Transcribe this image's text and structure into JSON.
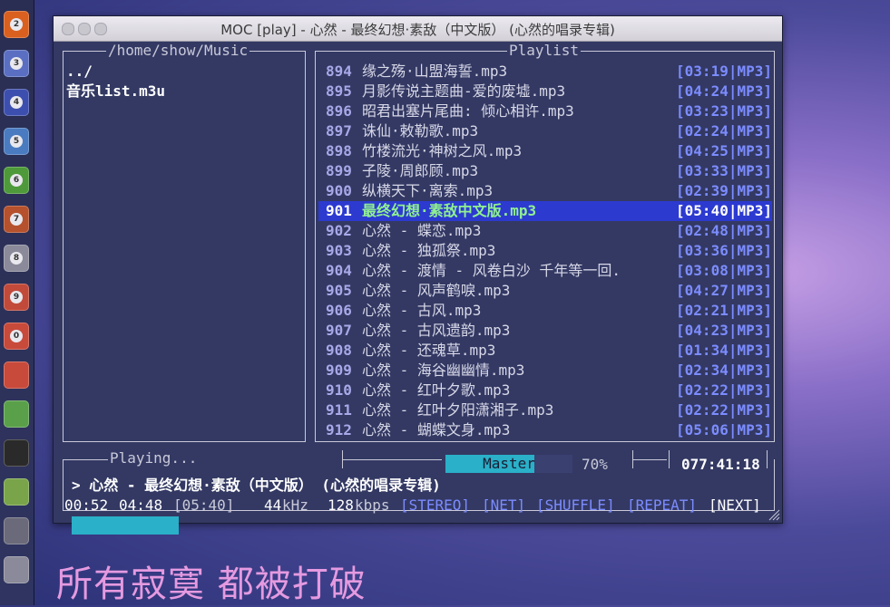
{
  "window": {
    "title": "MOC [play] - 心然 - 最终幻想·素敌（中文版） (心然的唱录专辑)"
  },
  "launcher": {
    "items": [
      {
        "icon": "firefox-icon",
        "badge": "2",
        "color": "#d9601f"
      },
      {
        "icon": "disk-icon",
        "badge": "3",
        "color": "#5a6fc2"
      },
      {
        "icon": "disk-icon",
        "badge": "4",
        "color": "#3d4fae"
      },
      {
        "icon": "writer-icon",
        "badge": "5",
        "color": "#4a7bc0"
      },
      {
        "icon": "calc-icon",
        "badge": "6",
        "color": "#4e9a3a"
      },
      {
        "icon": "impress-icon",
        "badge": "7",
        "color": "#b5512c"
      },
      {
        "icon": "disk-icon",
        "badge": "8",
        "color": "#8a8a9a"
      },
      {
        "icon": "software-center-icon",
        "badge": "9",
        "color": "#c24a3a"
      },
      {
        "icon": "app-icon",
        "badge": "0",
        "color": "#c84a3a"
      },
      {
        "icon": "settings-icon",
        "badge": "",
        "color": "#c84a3a"
      },
      {
        "icon": "update-icon",
        "badge": "",
        "color": "#5aa04a"
      },
      {
        "icon": "terminal-icon",
        "badge": "",
        "color": "#2a2a2a"
      },
      {
        "icon": "download-icon",
        "badge": "",
        "color": "#7aa44a"
      },
      {
        "icon": "workspace-icon",
        "badge": "",
        "color": "#6a6a7a"
      },
      {
        "icon": "trash-icon",
        "badge": "",
        "color": "#8a8a9a"
      }
    ]
  },
  "browser": {
    "path": "/home/show/Music",
    "entries": [
      "../",
      "音乐list.m3u"
    ]
  },
  "playlist": {
    "label": "Playlist",
    "rows": [
      {
        "n": "894",
        "name": "缘之殇·山盟海誓.mp3",
        "dur": "[03:19|MP3]"
      },
      {
        "n": "895",
        "name": "月影传说主题曲-爱的废墟.mp3",
        "dur": "[04:24|MP3]"
      },
      {
        "n": "896",
        "name": "昭君出塞片尾曲: 倾心相许.mp3",
        "dur": "[03:23|MP3]"
      },
      {
        "n": "897",
        "name": "诛仙·敕勒歌.mp3",
        "dur": "[02:24|MP3]"
      },
      {
        "n": "898",
        "name": "竹楼流光·神树之风.mp3",
        "dur": "[04:25|MP3]"
      },
      {
        "n": "899",
        "name": "子陵·周郎顾.mp3",
        "dur": "[03:33|MP3]"
      },
      {
        "n": "900",
        "name": "纵横天下·离索.mp3",
        "dur": "[02:39|MP3]"
      },
      {
        "n": "901",
        "name": "最终幻想·素敌中文版.mp3",
        "dur": "[05:40|MP3]"
      },
      {
        "n": "902",
        "name": "心然 - 蝶恋.mp3",
        "dur": "[02:48|MP3]"
      },
      {
        "n": "903",
        "name": "心然 - 独孤祭.mp3",
        "dur": "[03:36|MP3]"
      },
      {
        "n": "904",
        "name": "心然 - 渡情 - 风卷白沙 千年等一回.",
        "dur": "[03:08|MP3]"
      },
      {
        "n": "905",
        "name": "心然 - 风声鹤唳.mp3",
        "dur": "[04:27|MP3]"
      },
      {
        "n": "906",
        "name": "心然 - 古风.mp3",
        "dur": "[02:21|MP3]"
      },
      {
        "n": "907",
        "name": "心然 - 古风遗韵.mp3",
        "dur": "[04:23|MP3]"
      },
      {
        "n": "908",
        "name": "心然 - 还魂草.mp3",
        "dur": "[01:34|MP3]"
      },
      {
        "n": "909",
        "name": "心然 - 海谷幽幽情.mp3",
        "dur": "[02:34|MP3]"
      },
      {
        "n": "910",
        "name": "心然 - 红叶夕歌.mp3",
        "dur": "[02:22|MP3]"
      },
      {
        "n": "911",
        "name": "心然 - 红叶夕阳潇湘子.mp3",
        "dur": "[02:22|MP3]"
      },
      {
        "n": "912",
        "name": "心然 - 蝴蝶文身.mp3",
        "dur": "[05:06|MP3]"
      }
    ],
    "selected_index": 7
  },
  "status": {
    "playing_label": "Playing...",
    "mixer_label": "Master",
    "volume_pct": 70,
    "volume_text": "70%",
    "total_time": "077:41:18",
    "now_playing": "> 心然 - 最终幻想·素敌（中文版） (心然的唱录专辑)",
    "elapsed": "00:52",
    "remaining": "04:48",
    "total": "[05:40]",
    "rate_num": "44",
    "rate_unit": "kHz",
    "bitrate_num": "128",
    "bitrate_unit": "kbps",
    "stereo": "[STEREO]",
    "net": "[NET]",
    "shuffle": "[SHUFFLE]",
    "repeat": "[REPEAT]",
    "next": "[NEXT]",
    "progress_fraction": 0.153
  },
  "lyric": "所有寂寞 都被打破",
  "colors": {
    "terminal_bg": "#333963",
    "accent_cyan": "#2ab0c8",
    "selection_bg": "#2c3ad0",
    "duration_blue": "#7c8cff",
    "selected_song_green": "#90f090",
    "lyric_pink": "#e59ae0"
  }
}
